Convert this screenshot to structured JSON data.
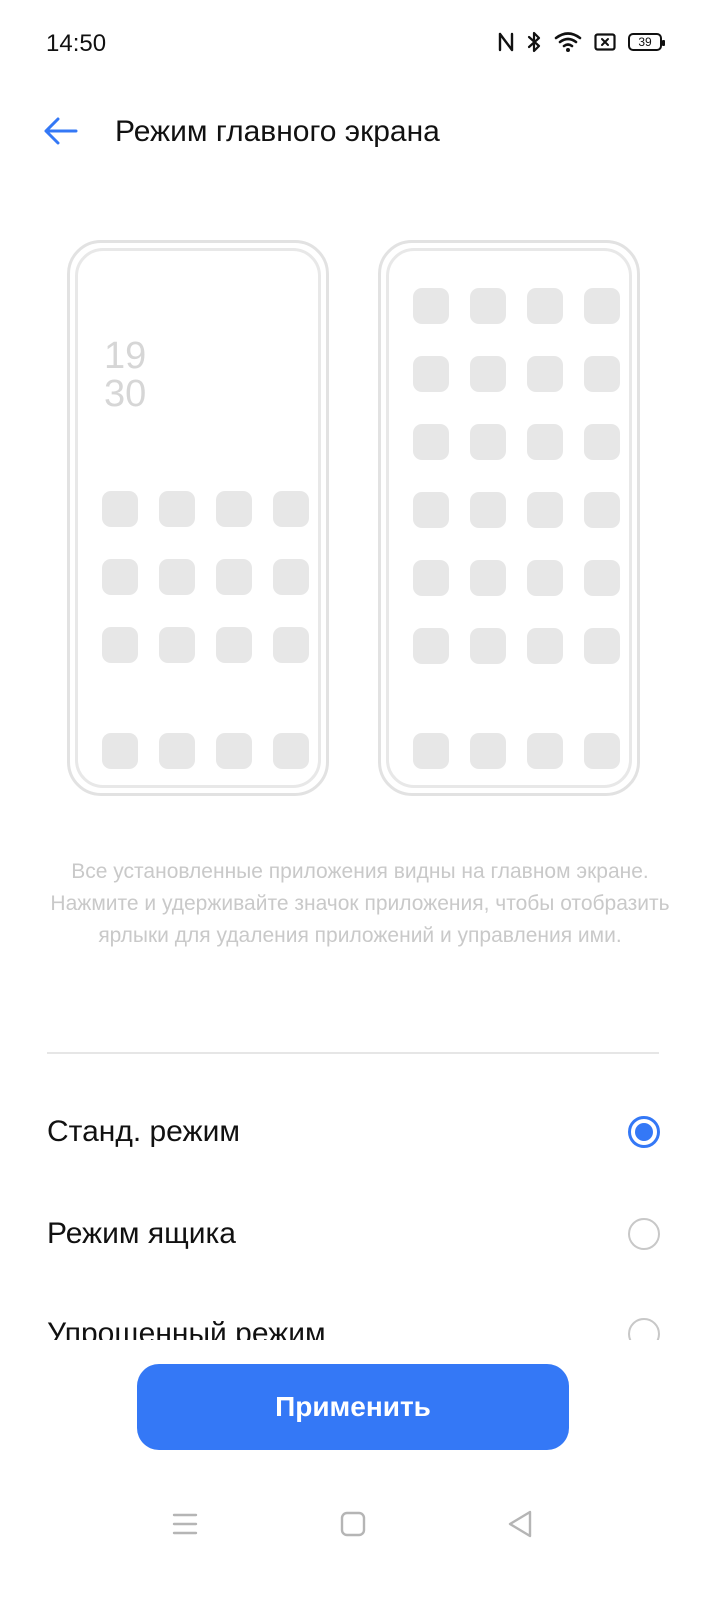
{
  "status_bar": {
    "time": "14:50",
    "battery_level": "39",
    "icons": [
      "nfc-icon",
      "bluetooth-icon",
      "wifi-icon",
      "sim-icon",
      "battery-icon"
    ]
  },
  "header": {
    "title": "Режим главного экрана"
  },
  "preview": {
    "clock_hours": "19",
    "clock_minutes": "30"
  },
  "description": "Все установленные приложения видны на главном экране. Нажмите и удерживайте значок приложения, чтобы отобразить ярлыки для удаления приложений и управления ими.",
  "options": [
    {
      "label": "Станд. режим",
      "selected": true
    },
    {
      "label": "Режим ящика",
      "selected": false
    },
    {
      "label": "Упрощенный режим",
      "selected": false
    }
  ],
  "apply_label": "Применить",
  "colors": {
    "accent": "#3478f6",
    "placeholder": "#e7e7e7",
    "description_text": "#c9c9c9"
  }
}
